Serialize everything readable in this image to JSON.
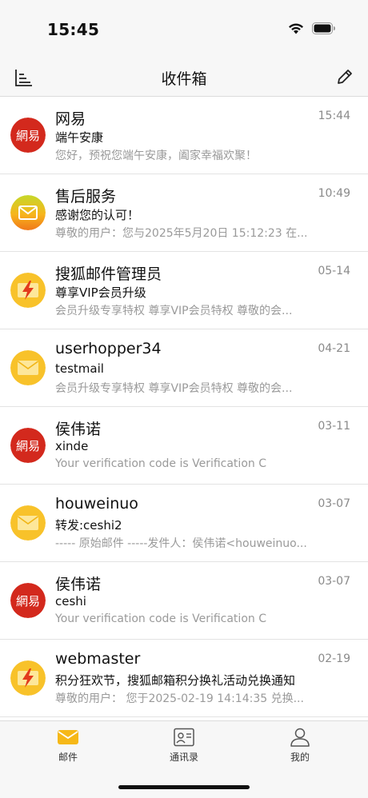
{
  "status_bar": {
    "time": "15:45"
  },
  "nav": {
    "title": "收件箱",
    "left_icon": "sort-icon",
    "right_icon": "compose-pencil-icon"
  },
  "mails": [
    {
      "sender": "网易",
      "time": "15:44",
      "subject": "端午安康",
      "preview": "您好，预祝您端午安康，阖家幸福欢聚！",
      "avatar": "netease",
      "avatar_text": "網易"
    },
    {
      "sender": "售后服务",
      "time": "10:49",
      "subject": "感谢您的认可！",
      "preview": "尊敬的用户：您与2025年5月20日 15:12:23 在...",
      "avatar": "service",
      "avatar_text": ""
    },
    {
      "sender": "搜狐邮件管理员",
      "time": "05-14",
      "subject": "尊享VIP会员升级",
      "preview": "会员升级专享特权 尊享VIP会员特权 尊敬的会...",
      "avatar": "sohu",
      "avatar_text": ""
    },
    {
      "sender": "userhopper34",
      "time": "04-21",
      "subject": "testmail",
      "preview": "会员升级专享特权 尊享VIP会员特权 尊敬的会...",
      "avatar": "envelope",
      "avatar_text": ""
    },
    {
      "sender": "侯伟诺",
      "time": "03-11",
      "subject": "xinde",
      "preview": "Your verification code is Verification C",
      "avatar": "netease",
      "avatar_text": "網易"
    },
    {
      "sender": "houweinuo",
      "time": "03-07",
      "subject": "转发:ceshi2",
      "preview": "----- 原始邮件 -----发件人：侯伟诺<houweinuo...",
      "avatar": "envelope",
      "avatar_text": ""
    },
    {
      "sender": "侯伟诺",
      "time": "03-07",
      "subject": "ceshi",
      "preview": "Your verification code is Verification C",
      "avatar": "netease",
      "avatar_text": "網易"
    },
    {
      "sender": "webmaster",
      "time": "02-19",
      "subject": "积分狂欢节，搜狐邮箱积分换礼活动兑换通知",
      "preview": "尊敬的用户：  您于2025-02-19 14:14:35 兑换...",
      "avatar": "sohu",
      "avatar_text": ""
    }
  ],
  "tabs": [
    {
      "label": "邮件",
      "icon": "mail-icon",
      "active": true
    },
    {
      "label": "通讯录",
      "icon": "contacts-icon",
      "active": false
    },
    {
      "label": "我的",
      "icon": "person-icon",
      "active": false
    }
  ],
  "colors": {
    "accent": "#f6b818",
    "netease_red": "#d3291d",
    "text_primary": "#111111",
    "text_secondary": "#9a9a9a"
  }
}
